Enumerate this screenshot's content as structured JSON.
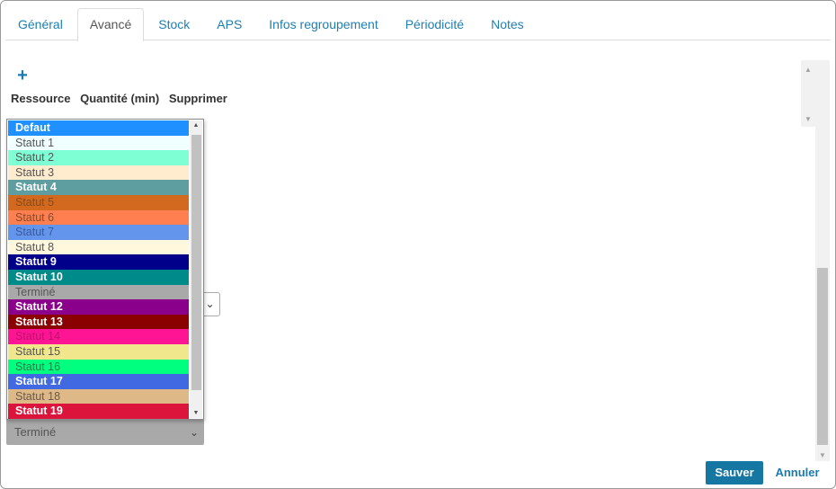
{
  "tabs": [
    {
      "label": "Général"
    },
    {
      "label": "Avancé",
      "active": true
    },
    {
      "label": "Stock"
    },
    {
      "label": "APS"
    },
    {
      "label": "Infos regroupement"
    },
    {
      "label": "Périodicité"
    },
    {
      "label": "Notes"
    }
  ],
  "section": {
    "add_icon": "plus-icon",
    "add_label": "+",
    "columns": [
      "Ressource",
      "Quantité (min)",
      "Supprimer"
    ]
  },
  "status_list": {
    "options": [
      {
        "label": "Defaut",
        "bg": "#1E90FF",
        "fg": "#ffffff",
        "bold": true
      },
      {
        "label": "Statut 1",
        "bg": "#F0FFFF",
        "fg": "#555555"
      },
      {
        "label": "Statut 2",
        "bg": "#7FFFD4",
        "fg": "#555555"
      },
      {
        "label": "Statut 3",
        "bg": "#FFEBCD",
        "fg": "#555555"
      },
      {
        "label": "Statut 4",
        "bg": "#5F9EA0",
        "fg": "#ffffff",
        "bold": true
      },
      {
        "label": "Statut 5",
        "bg": "#D2691E",
        "fg": "#8a4a1a"
      },
      {
        "label": "Statut 6",
        "bg": "#FF7F50",
        "fg": "#8a4a2a"
      },
      {
        "label": "Statut 7",
        "bg": "#6495ED",
        "fg": "#3a5a9a"
      },
      {
        "label": "Statut 8",
        "bg": "#FFF8DC",
        "fg": "#555555"
      },
      {
        "label": "Statut 9",
        "bg": "#00008B",
        "fg": "#ffffff",
        "bold": true
      },
      {
        "label": "Statut 10",
        "bg": "#008B8B",
        "fg": "#ffffff",
        "bold": true
      },
      {
        "label": "Terminé",
        "bg": "#A9A9A9",
        "fg": "#555555"
      },
      {
        "label": "Statut 12",
        "bg": "#8B008B",
        "fg": "#ffffff",
        "bold": true
      },
      {
        "label": "Statut 13",
        "bg": "#8B0000",
        "fg": "#ffffff",
        "bold": true
      },
      {
        "label": "Statut 14",
        "bg": "#FF1493",
        "fg": "#c01070"
      },
      {
        "label": "Statut 15",
        "bg": "#F0E68C",
        "fg": "#555555"
      },
      {
        "label": "Statut 16",
        "bg": "#00FF7F",
        "fg": "#2a7a4a"
      },
      {
        "label": "Statut 17",
        "bg": "#4169E1",
        "fg": "#ffffff",
        "bold": true
      },
      {
        "label": "Statut 18",
        "bg": "#DEB887",
        "fg": "#6a5a4a"
      },
      {
        "label": "Statut 19",
        "bg": "#DC143C",
        "fg": "#ffffff",
        "bold": true
      }
    ]
  },
  "selected_value": "Terminé",
  "footer": {
    "save_label": "Sauver",
    "cancel_label": "Annuler"
  }
}
